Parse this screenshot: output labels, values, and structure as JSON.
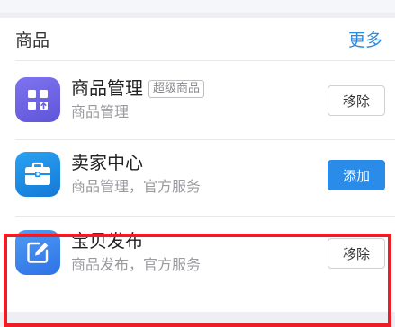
{
  "section": {
    "title": "商品",
    "more_label": "更多"
  },
  "items": [
    {
      "title": "商品管理",
      "tag": "超级商品",
      "subtitle": "商品管理",
      "button_label": "移除",
      "icon": "grid-upload-icon"
    },
    {
      "title": "卖家中心",
      "subtitle": "商品管理，官方服务",
      "button_label": "添加",
      "icon": "briefcase-icon"
    },
    {
      "title": "宝贝发布",
      "subtitle": "商品发布，官方服务",
      "button_label": "移除",
      "icon": "edit-icon"
    }
  ],
  "colors": {
    "accent": "#2b8be8",
    "highlight": "#ee1c24",
    "icon_purple": "#6d63e4",
    "icon_blue": "#1e8fe6",
    "icon_lightblue": "#3f86ee"
  }
}
